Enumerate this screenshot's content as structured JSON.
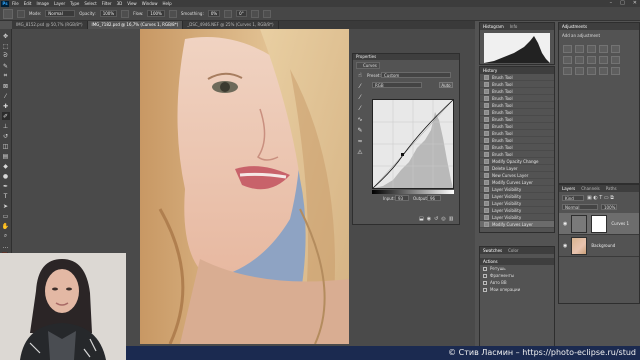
{
  "app": {
    "logo": "Ps"
  },
  "menubar": {
    "items": [
      "File",
      "Edit",
      "Image",
      "Layer",
      "Type",
      "Select",
      "Filter",
      "3D",
      "View",
      "Window",
      "Help"
    ],
    "window_controls": [
      "–",
      "□",
      "✕"
    ]
  },
  "optbar": {
    "mode_label": "Mode:",
    "mode_value": "Normal",
    "opacity_label": "Opacity:",
    "opacity_value": "100%",
    "flow_label": "Flow:",
    "flow_value": "100%",
    "smoothing_label": "Smoothing:",
    "smoothing_value": "0%",
    "angle_value": "0°"
  },
  "tabs": [
    {
      "label": "IMG_8152.psd @ 50,7% (RGB/8*)",
      "active": false
    },
    {
      "label": "IMG_7182.psd @ 16,7% (Curves 1, RGB/8*)",
      "active": true
    },
    {
      "label": "_DSC_4946.NEF @ 25% (Curves 1, RGB/8*)",
      "active": false
    }
  ],
  "properties": {
    "title": "Properties",
    "subtitle": "Curves",
    "preset_label": "Preset:",
    "preset_value": "Custom",
    "channel_value": "RGB",
    "auto_label": "Auto",
    "input_label": "Input:",
    "input_value": "93",
    "output_label": "Output:",
    "output_value": "96"
  },
  "histogram": {
    "tabs": [
      "Histogram",
      "Info"
    ]
  },
  "history": {
    "tab": "History",
    "items": [
      "Brush Tool",
      "Brush Tool",
      "Brush Tool",
      "Brush Tool",
      "Brush Tool",
      "Brush Tool",
      "Brush Tool",
      "Brush Tool",
      "Brush Tool",
      "Brush Tool",
      "Brush Tool",
      "Brush Tool",
      "Modify Opacity Change",
      "Delete Layer",
      "New Curves Layer",
      "Modify Curves Layer",
      "Layer Visibility",
      "Layer Visibility",
      "Layer Visibility",
      "Layer Visibility",
      "Layer Visibility",
      "Modify Curves Layer"
    ]
  },
  "actions": {
    "tabs": [
      "Swatches",
      "Color"
    ],
    "tab2": "Actions",
    "items": [
      "Ретушь",
      "Фрагменты",
      "Авто BB",
      "Мои операции"
    ]
  },
  "adjustments": {
    "tabs": [
      "Adjustments"
    ],
    "hint": "Add an adjustment"
  },
  "layers": {
    "tabs": [
      "Layers",
      "Channels",
      "Paths"
    ],
    "kind_label": "Kind",
    "blend_value": "Normal",
    "opacity_value": "100%",
    "items": [
      {
        "name": "Curves 1",
        "selected": true
      },
      {
        "name": "Background",
        "selected": false
      }
    ]
  },
  "watermark": {
    "text": "© Стив Ласмин – https://photo-eclipse.ru/stud"
  },
  "colors": {
    "accent": "#31a8ff",
    "panel": "#535353",
    "bar": "#1b2a50"
  }
}
